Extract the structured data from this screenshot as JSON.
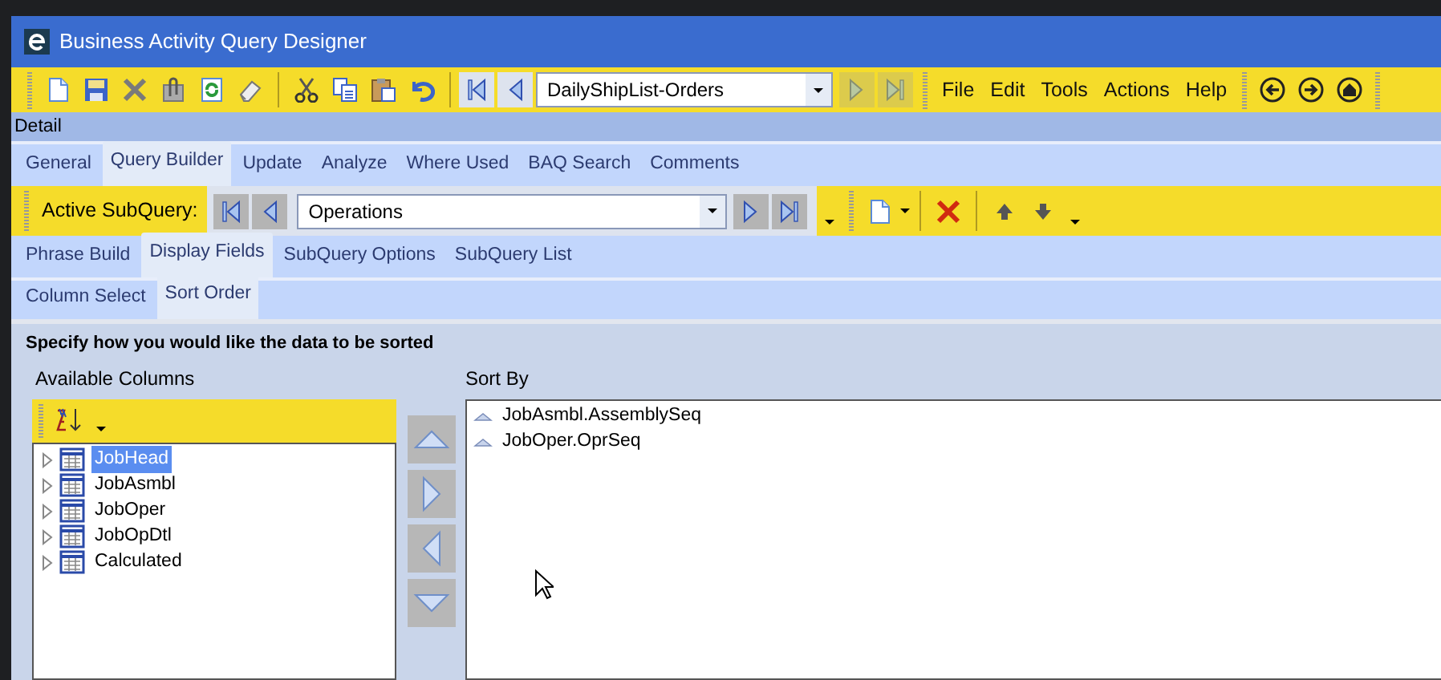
{
  "window": {
    "title": "Business Activity Query Designer"
  },
  "toolbar": {
    "record": "DailyShipList-Orders",
    "menus": [
      "File",
      "Edit",
      "Tools",
      "Actions",
      "Help"
    ]
  },
  "detail_label": "Detail",
  "tabs": [
    {
      "label": "General",
      "selected": false
    },
    {
      "label": "Query Builder",
      "selected": true
    },
    {
      "label": "Update",
      "selected": false
    },
    {
      "label": "Analyze",
      "selected": false
    },
    {
      "label": "Where Used",
      "selected": false
    },
    {
      "label": "BAQ Search",
      "selected": false
    },
    {
      "label": "Comments",
      "selected": false
    }
  ],
  "subquery": {
    "label": "Active SubQuery:",
    "value": "Operations"
  },
  "subtabs": [
    {
      "label": "Phrase Build",
      "selected": false
    },
    {
      "label": "Display Fields",
      "selected": true
    },
    {
      "label": "SubQuery Options",
      "selected": false
    },
    {
      "label": "SubQuery List",
      "selected": false
    }
  ],
  "sort_tabs": [
    {
      "label": "Column Select",
      "selected": false
    },
    {
      "label": "Sort Order",
      "selected": true
    }
  ],
  "instruction": "Specify how you would like the data to be sorted",
  "available_columns": {
    "label": "Available Columns",
    "items": [
      {
        "label": "JobHead",
        "selected": true
      },
      {
        "label": "JobAsmbl",
        "selected": false
      },
      {
        "label": "JobOper",
        "selected": false
      },
      {
        "label": "JobOpDtl",
        "selected": false
      },
      {
        "label": "Calculated",
        "selected": false
      }
    ]
  },
  "sort_by": {
    "label": "Sort By",
    "items": [
      {
        "label": "JobAsmbl.AssemblySeq"
      },
      {
        "label": "JobOper.OprSeq"
      }
    ]
  }
}
